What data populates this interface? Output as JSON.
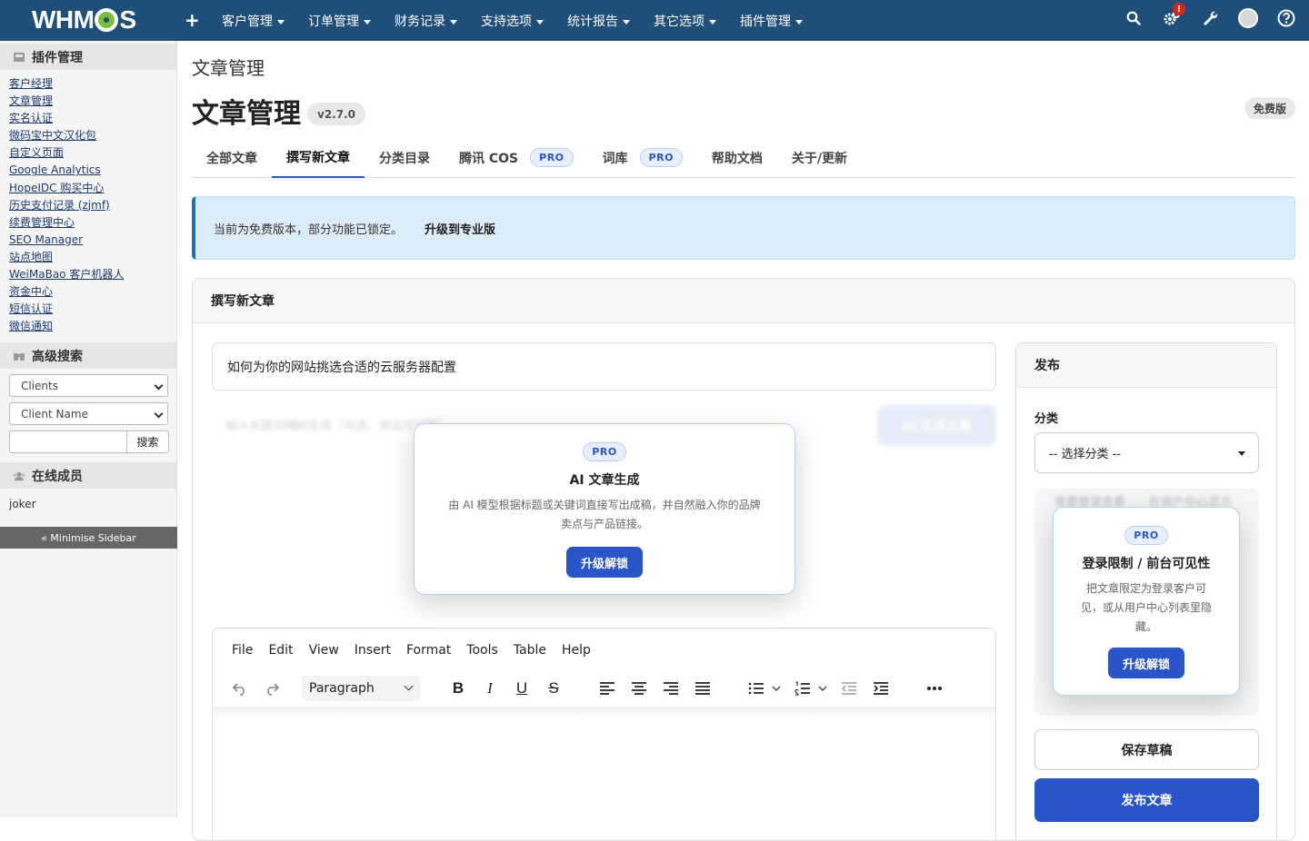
{
  "topbar": {
    "logo_text_left": "WHM",
    "logo_text_right": "S",
    "plus": "+",
    "menu": [
      "客户管理",
      "订单管理",
      "财务记录",
      "支持选项",
      "统计报告",
      "其它选项",
      "插件管理"
    ],
    "notification_badge": "!"
  },
  "sidebar": {
    "addons_heading": "插件管理",
    "addons": [
      "客户经理",
      "文章管理",
      "实名认证",
      "微码宝中文汉化包",
      "自定义页面",
      "Google Analytics",
      "HopeIDC 购买中心",
      "历史支付记录 (zjmf)",
      "续费管理中心",
      "SEO Manager",
      "站点地图",
      "WeiMaBao 客户机器人",
      "资金中心",
      "短信认证",
      "微信通知"
    ],
    "search_heading": "高级搜索",
    "select_type": "Clients",
    "select_field": "Client Name",
    "search_button": "搜索",
    "online_heading": "在线成员",
    "online_user": "joker",
    "minimise": "« Minimise Sidebar"
  },
  "main": {
    "breadcrumb": "文章管理",
    "title": "文章管理",
    "version": "v2.7.0",
    "edition": "免费版",
    "tabs": [
      {
        "label": "全部文章",
        "pro": ""
      },
      {
        "label": "撰写新文章",
        "pro": ""
      },
      {
        "label": "分类目录",
        "pro": ""
      },
      {
        "label": "腾讯 COS",
        "pro": "PRO"
      },
      {
        "label": "词库",
        "pro": "PRO"
      },
      {
        "label": "帮助文档",
        "pro": ""
      },
      {
        "label": "关于/更新",
        "pro": ""
      }
    ],
    "alert_text": "当前为免费版本，部分功能已锁定。",
    "alert_link": "升级到专业版",
    "panel_title": "撰写新文章",
    "post_title_value": "如何为你的网站挑选合适的云服务器配置",
    "ai_keywords_placeholder": "输入关键词辅助生成（可选，用逗号分隔）...",
    "ai_generate_button": "AI 生成文章",
    "ai_lock": {
      "badge": "PRO",
      "title": "AI 文章生成",
      "desc_line1": "由 AI 模型根据标题或关键词直接写出成稿，并自然融入你的品牌",
      "desc_line2": "卖点与产品链接。",
      "button": "升级解锁"
    },
    "editor": {
      "menus": [
        "File",
        "Edit",
        "View",
        "Insert",
        "Format",
        "Tools",
        "Table",
        "Help"
      ],
      "block_format": "Paragraph"
    },
    "publish": {
      "heading": "发布",
      "category_label": "分类",
      "category_value": "-- 选择分类 --",
      "opt_login": "需要登录查看",
      "opt_show": "在用户中心显示",
      "lock": {
        "badge": "PRO",
        "title": "登录限制 / 前台可见性",
        "desc_line1": "把文章限定为登录客户可",
        "desc_line2": "见，或从用户中心列表里隐",
        "desc_line3": "藏。",
        "button": "升级解锁"
      },
      "save_draft": "保存草稿",
      "publish_button": "发布文章"
    }
  }
}
